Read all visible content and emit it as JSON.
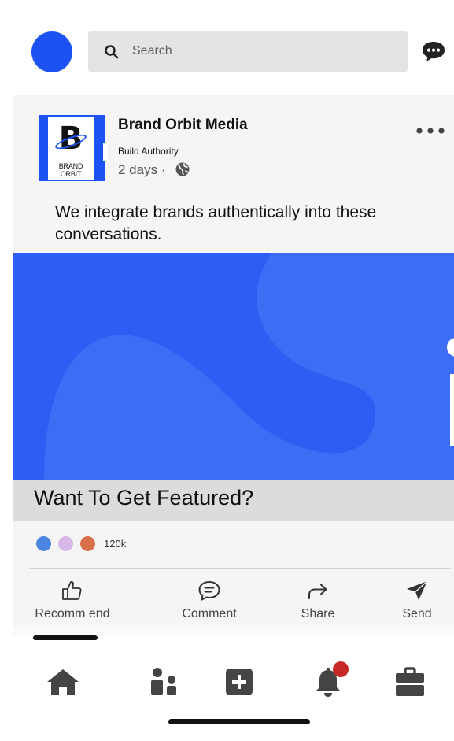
{
  "header": {
    "search_placeholder": "Search",
    "icons": {
      "search": "search-icon",
      "messages": "chat-bubble-icon"
    }
  },
  "post": {
    "author": "Brand Orbit Media",
    "subtitle": "Build Authority",
    "timestamp": "2 days ·",
    "logo": {
      "text": "BRAND ORBIT"
    },
    "body": "We integrate brands authentically into these conversations.",
    "media_caption": "Want To Get Featured?",
    "reactions": {
      "count": "120k",
      "colors": [
        "#4a86e0",
        "#d8b8e8",
        "#d9704c"
      ]
    },
    "actions": [
      {
        "label": "Recomm end",
        "icon": "thumbs-up-icon"
      },
      {
        "label": "Comment",
        "icon": "comment-icon"
      },
      {
        "label": "Share",
        "icon": "share-arrow-icon"
      },
      {
        "label": "Send",
        "icon": "send-icon"
      }
    ]
  },
  "nav": {
    "items": [
      "home-icon",
      "network-icon",
      "post-add-icon",
      "notifications-icon",
      "jobs-icon"
    ],
    "notification_badge": true
  },
  "colors": {
    "brand_blue": "#1a53f2",
    "media_blue": "#2d5ef3",
    "badge_red": "#c62828"
  }
}
